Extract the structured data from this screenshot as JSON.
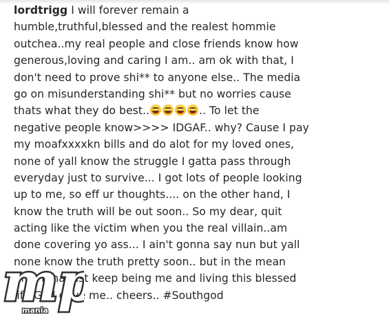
{
  "post": {
    "username": "lordtrigg",
    "lines": [
      " I will forever remain a",
      "humble,truthful,blessed and the realest hommie",
      "outchea..my real people and close friends know how",
      "generous,loving and caring I am.. am ok with that, I",
      "don't need to prove shi** to anyone else.. The media",
      "go on misunderstanding shi** but no worries cause",
      "thats what they do best..",
      "negative people know>>>> IDGAF.. why? Cause I pay",
      "my moafxxxxkn bills and do alot for my loved ones,",
      "none of yall know the struggle I gatta pass through",
      "everyday just to survive... I got lots of people looking",
      "up to me, so eff ur thoughts.... on the other hand, I",
      "know the truth will be out soon.. So my dear, quit",
      "acting like the victim when you the real villain..am",
      "done covering yo ass... I ain't gonna say nun but yall",
      "none know the truth pretty soon.. but in the mean",
      "time ama just keep being me and living this blessed",
      "life God gave me.. cheers.. #Southgod"
    ],
    "line7_tail": ".. To let the",
    "emoji": [
      "laughing-emoji",
      "laughing-emoji",
      "laughing-emoji",
      "laughing-emoji"
    ]
  },
  "watermark": {
    "logo_text": "mp",
    "sub_text": "mania"
  }
}
